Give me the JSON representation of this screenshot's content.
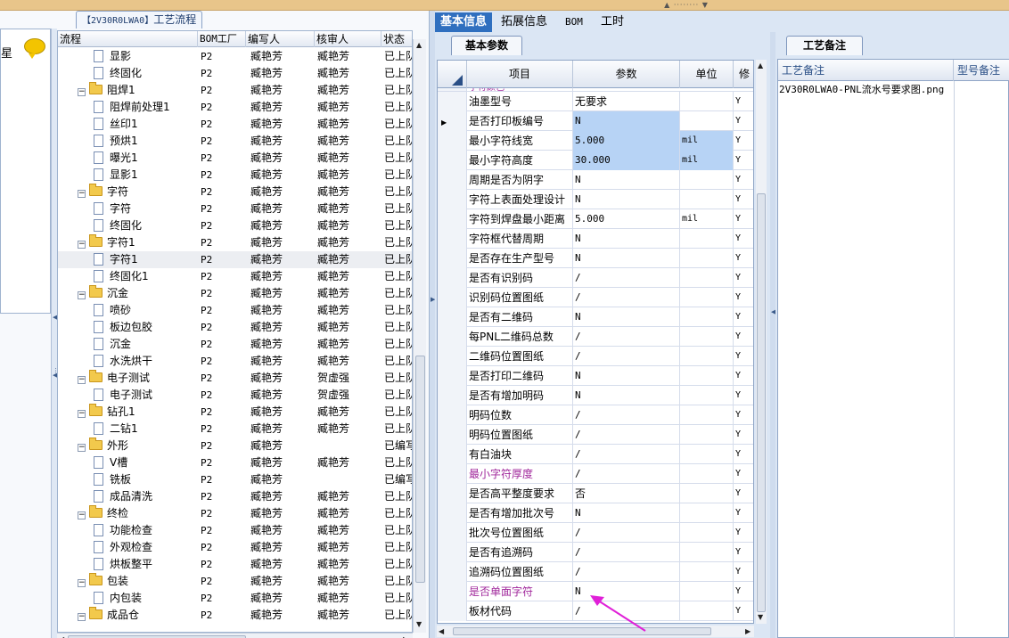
{
  "left_panel": {
    "title_code": "【2V30R0LWA0】",
    "title_text": "工艺流程",
    "narrow_cut_text": "星",
    "columns": [
      "流程",
      "BOM工厂",
      "编写人",
      "核审人",
      "状态"
    ],
    "rows": [
      {
        "type": "step",
        "name": "显影",
        "bom": "P2",
        "writer": "臧艳芳",
        "reviewer": "臧艳芳",
        "status": "已上队"
      },
      {
        "type": "step",
        "name": "终固化",
        "bom": "P2",
        "writer": "臧艳芳",
        "reviewer": "臧艳芳",
        "status": "已上队"
      },
      {
        "type": "group",
        "name": "阻焊1",
        "bom": "P2",
        "writer": "臧艳芳",
        "reviewer": "臧艳芳",
        "status": "已上队"
      },
      {
        "type": "step",
        "name": "阻焊前处理1",
        "bom": "P2",
        "writer": "臧艳芳",
        "reviewer": "臧艳芳",
        "status": "已上队"
      },
      {
        "type": "step",
        "name": "丝印1",
        "bom": "P2",
        "writer": "臧艳芳",
        "reviewer": "臧艳芳",
        "status": "已上队"
      },
      {
        "type": "step",
        "name": "预烘1",
        "bom": "P2",
        "writer": "臧艳芳",
        "reviewer": "臧艳芳",
        "status": "已上队"
      },
      {
        "type": "step",
        "name": "曝光1",
        "bom": "P2",
        "writer": "臧艳芳",
        "reviewer": "臧艳芳",
        "status": "已上队"
      },
      {
        "type": "step",
        "name": "显影1",
        "bom": "P2",
        "writer": "臧艳芳",
        "reviewer": "臧艳芳",
        "status": "已上队"
      },
      {
        "type": "group",
        "name": "字符",
        "bom": "P2",
        "writer": "臧艳芳",
        "reviewer": "臧艳芳",
        "status": "已上队"
      },
      {
        "type": "step",
        "name": "字符",
        "bom": "P2",
        "writer": "臧艳芳",
        "reviewer": "臧艳芳",
        "status": "已上队"
      },
      {
        "type": "step",
        "name": "终固化",
        "bom": "P2",
        "writer": "臧艳芳",
        "reviewer": "臧艳芳",
        "status": "已上队"
      },
      {
        "type": "group",
        "name": "字符1",
        "bom": "P2",
        "writer": "臧艳芳",
        "reviewer": "臧艳芳",
        "status": "已上队"
      },
      {
        "type": "step",
        "name": "字符1",
        "bom": "P2",
        "writer": "臧艳芳",
        "reviewer": "臧艳芳",
        "status": "已上队",
        "selected": true
      },
      {
        "type": "step",
        "name": "终固化1",
        "bom": "P2",
        "writer": "臧艳芳",
        "reviewer": "臧艳芳",
        "status": "已上队"
      },
      {
        "type": "group",
        "name": "沉金",
        "bom": "P2",
        "writer": "臧艳芳",
        "reviewer": "臧艳芳",
        "status": "已上队"
      },
      {
        "type": "step",
        "name": "喷砂",
        "bom": "P2",
        "writer": "臧艳芳",
        "reviewer": "臧艳芳",
        "status": "已上队"
      },
      {
        "type": "step",
        "name": "板边包胶",
        "bom": "P2",
        "writer": "臧艳芳",
        "reviewer": "臧艳芳",
        "status": "已上队"
      },
      {
        "type": "step",
        "name": "沉金",
        "bom": "P2",
        "writer": "臧艳芳",
        "reviewer": "臧艳芳",
        "status": "已上队"
      },
      {
        "type": "step",
        "name": "水洗烘干",
        "bom": "P2",
        "writer": "臧艳芳",
        "reviewer": "臧艳芳",
        "status": "已上队"
      },
      {
        "type": "group",
        "name": "电子测试",
        "bom": "P2",
        "writer": "臧艳芳",
        "reviewer": "贺虚强",
        "status": "已上队"
      },
      {
        "type": "step",
        "name": "电子测试",
        "bom": "P2",
        "writer": "臧艳芳",
        "reviewer": "贺虚强",
        "status": "已上队"
      },
      {
        "type": "group",
        "name": "钻孔1",
        "bom": "P2",
        "writer": "臧艳芳",
        "reviewer": "臧艳芳",
        "status": "已上队"
      },
      {
        "type": "step",
        "name": "二钻1",
        "bom": "P2",
        "writer": "臧艳芳",
        "reviewer": "臧艳芳",
        "status": "已上队"
      },
      {
        "type": "group",
        "name": "外形",
        "bom": "P2",
        "writer": "臧艳芳",
        "reviewer": "",
        "status": "已编写"
      },
      {
        "type": "step",
        "name": "V槽",
        "bom": "P2",
        "writer": "臧艳芳",
        "reviewer": "臧艳芳",
        "status": "已上队"
      },
      {
        "type": "step",
        "name": "铣板",
        "bom": "P2",
        "writer": "臧艳芳",
        "reviewer": "",
        "status": "已编写"
      },
      {
        "type": "step",
        "name": "成品清洗",
        "bom": "P2",
        "writer": "臧艳芳",
        "reviewer": "臧艳芳",
        "status": "已上队"
      },
      {
        "type": "group",
        "name": "终检",
        "bom": "P2",
        "writer": "臧艳芳",
        "reviewer": "臧艳芳",
        "status": "已上队"
      },
      {
        "type": "step",
        "name": "功能检查",
        "bom": "P2",
        "writer": "臧艳芳",
        "reviewer": "臧艳芳",
        "status": "已上队"
      },
      {
        "type": "step",
        "name": "外观检查",
        "bom": "P2",
        "writer": "臧艳芳",
        "reviewer": "臧艳芳",
        "status": "已上队"
      },
      {
        "type": "step",
        "name": "烘板整平",
        "bom": "P2",
        "writer": "臧艳芳",
        "reviewer": "臧艳芳",
        "status": "已上队"
      },
      {
        "type": "group",
        "name": "包装",
        "bom": "P2",
        "writer": "臧艳芳",
        "reviewer": "臧艳芳",
        "status": "已上队"
      },
      {
        "type": "step",
        "name": "内包装",
        "bom": "P2",
        "writer": "臧艳芳",
        "reviewer": "臧艳芳",
        "status": "已上队"
      },
      {
        "type": "group",
        "name": "成品仓",
        "bom": "P2",
        "writer": "臧艳芳",
        "reviewer": "臧艳芳",
        "status": "已上队"
      }
    ]
  },
  "top_tabs": [
    {
      "label": "基本信息",
      "active": true
    },
    {
      "label": "拓展信息",
      "active": false
    },
    {
      "label": "BOM",
      "active": false
    },
    {
      "label": "工时",
      "active": false
    }
  ],
  "params_panel": {
    "subtab": "基本参数",
    "columns": [
      "项目",
      "参数",
      "单位",
      "修"
    ],
    "cut_top_text": "字符颜色",
    "rows": [
      {
        "item": "油墨型号",
        "param": "无要求",
        "unit": "",
        "flag": "Y"
      },
      {
        "item": "是否打印板编号",
        "param": "N",
        "unit": "",
        "flag": "Y",
        "current": true,
        "highlight": true
      },
      {
        "item": "最小字符线宽",
        "param": "5.000",
        "unit": "mil",
        "flag": "Y",
        "highlight": true
      },
      {
        "item": "最小字符高度",
        "param": "30.000",
        "unit": "mil",
        "flag": "Y",
        "highlight": true
      },
      {
        "item": "周期是否为阴字",
        "param": "N",
        "unit": "",
        "flag": "Y"
      },
      {
        "item": "字符上表面处理设计",
        "param": "N",
        "unit": "",
        "flag": "Y"
      },
      {
        "item": "字符到焊盘最小距离",
        "param": "5.000",
        "unit": "mil",
        "flag": "Y"
      },
      {
        "item": "字符框代替周期",
        "param": "N",
        "unit": "",
        "flag": "Y"
      },
      {
        "item": "是否存在生产型号",
        "param": "N",
        "unit": "",
        "flag": "Y"
      },
      {
        "item": "是否有识别码",
        "param": "/",
        "unit": "",
        "flag": "Y"
      },
      {
        "item": "识别码位置图纸",
        "param": "/",
        "unit": "",
        "flag": "Y"
      },
      {
        "item": "是否有二维码",
        "param": "N",
        "unit": "",
        "flag": "Y"
      },
      {
        "item": "每PNL二维码总数",
        "param": "/",
        "unit": "",
        "flag": "Y"
      },
      {
        "item": "二维码位置图纸",
        "param": "/",
        "unit": "",
        "flag": "Y"
      },
      {
        "item": "是否打印二维码",
        "param": "N",
        "unit": "",
        "flag": "Y"
      },
      {
        "item": "是否有增加明码",
        "param": "N",
        "unit": "",
        "flag": "Y"
      },
      {
        "item": "明码位数",
        "param": "/",
        "unit": "",
        "flag": "Y"
      },
      {
        "item": "明码位置图纸",
        "param": "/",
        "unit": "",
        "flag": "Y"
      },
      {
        "item": "有白油块",
        "param": "/",
        "unit": "",
        "flag": "Y"
      },
      {
        "item": "最小字符厚度",
        "param": "/",
        "unit": "",
        "flag": "Y",
        "purple": true
      },
      {
        "item": "是否高平整度要求",
        "param": "否",
        "unit": "",
        "flag": "Y"
      },
      {
        "item": "是否有增加批次号",
        "param": "N",
        "unit": "",
        "flag": "Y"
      },
      {
        "item": "批次号位置图纸",
        "param": "/",
        "unit": "",
        "flag": "Y"
      },
      {
        "item": "是否有追溯码",
        "param": "/",
        "unit": "",
        "flag": "Y"
      },
      {
        "item": "追溯码位置图纸",
        "param": "/",
        "unit": "",
        "flag": "Y"
      },
      {
        "item": "是否单面字符",
        "param": "N",
        "unit": "",
        "flag": "Y",
        "purple": true
      },
      {
        "item": "板材代码",
        "param": "/",
        "unit": "",
        "flag": "Y"
      }
    ]
  },
  "remarks_panel": {
    "tab": "工艺备注",
    "columns": [
      "工艺备注",
      "型号备注"
    ],
    "remark_text": "2V30R0LWA0-PNL流水号要求图.png"
  },
  "colors": {
    "accent": "#2f6fbf",
    "highlight": "#b7d3f5",
    "purple_text": "#a0279b",
    "annotation_arrow": "#e020d8"
  }
}
